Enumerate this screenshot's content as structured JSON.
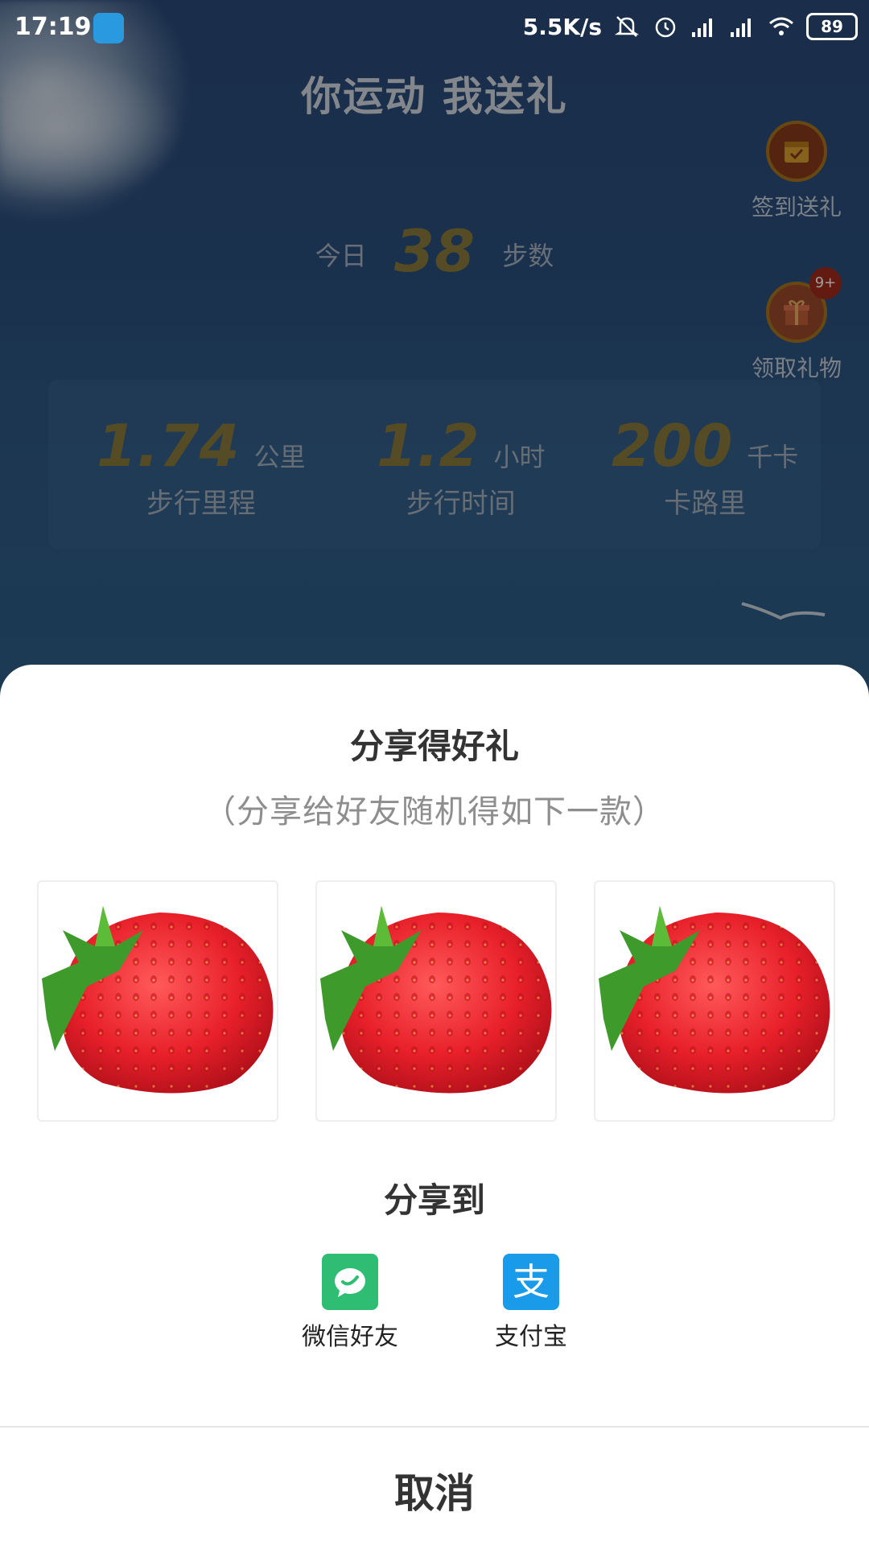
{
  "status_bar": {
    "time": "17:19",
    "net_speed": "5.5K/s",
    "battery": "89"
  },
  "header": {
    "title": "你运动 我送礼"
  },
  "side_buttons": [
    {
      "label": "签到送礼",
      "icon": "calendar-check-icon"
    },
    {
      "label": "领取礼物",
      "icon": "gift-icon",
      "badge": "9+"
    }
  ],
  "today": {
    "prefix": "今日",
    "steps": "38",
    "suffix": "步数"
  },
  "stats": [
    {
      "value": "1.74",
      "unit": "公里",
      "label": "步行里程"
    },
    {
      "value": "1.2",
      "unit": "小时",
      "label": "步行时间"
    },
    {
      "value": "200",
      "unit": "千卡",
      "label": "卡路里"
    }
  ],
  "share_sheet": {
    "title": "分享得好礼",
    "subtitle": "（分享给好友随机得如下一款）",
    "prizes": [
      {
        "icon": "strawberry-image"
      },
      {
        "icon": "strawberry-image"
      },
      {
        "icon": "strawberry-image"
      }
    ],
    "share_to_label": "分享到",
    "options": [
      {
        "label": "微信好友",
        "icon": "wechat-icon",
        "color": "#2fbd73"
      },
      {
        "label": "支付宝",
        "icon": "alipay-icon",
        "color": "#1a9bea"
      }
    ],
    "cancel_label": "取消"
  }
}
